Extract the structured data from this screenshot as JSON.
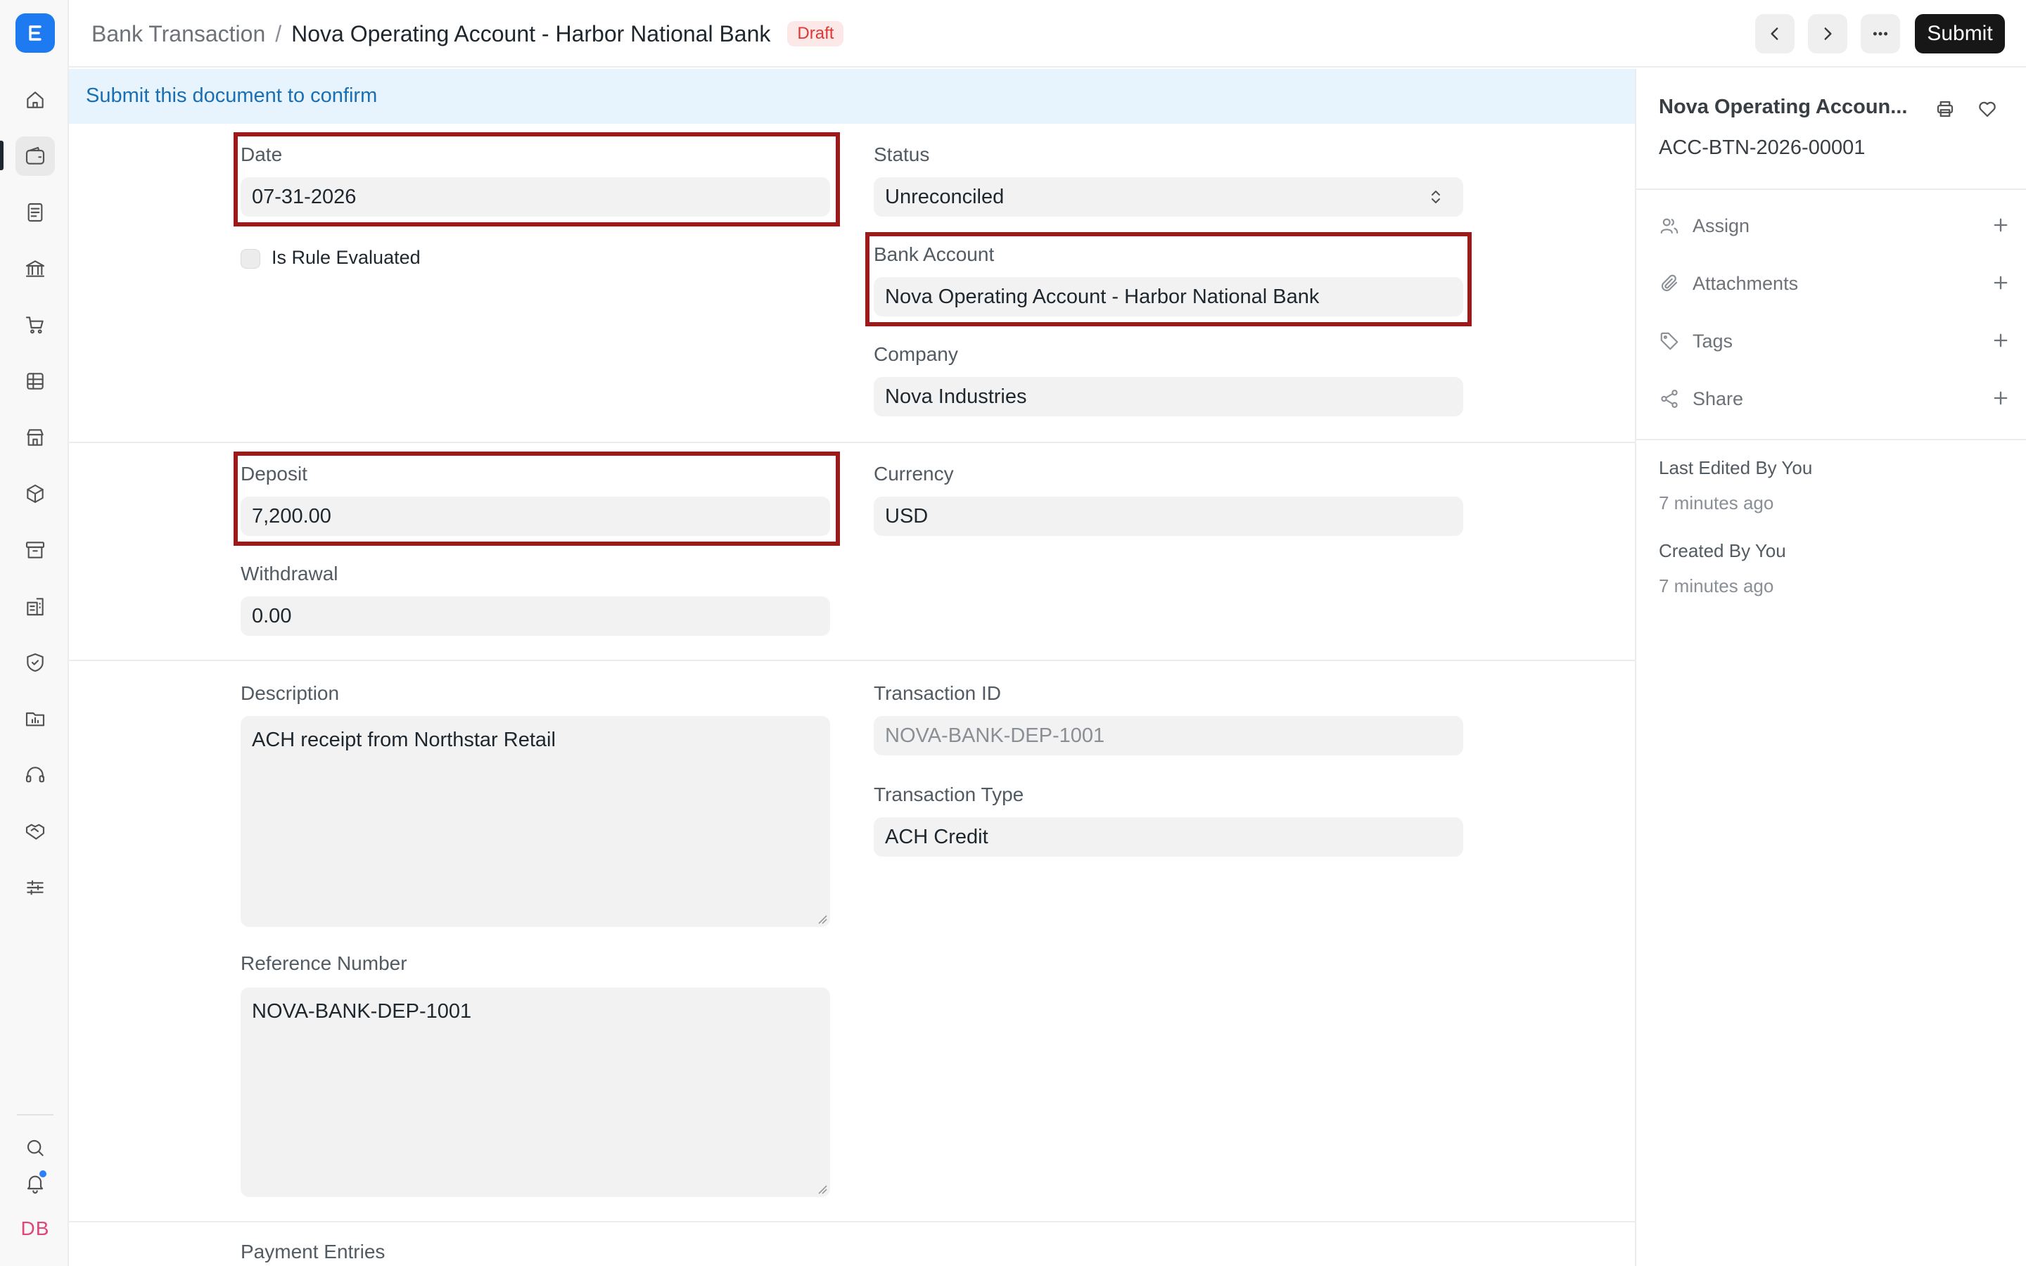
{
  "app": {
    "logo_letter": "E",
    "avatar_initials": "DB"
  },
  "breadcrumb": {
    "parent": "Bank Transaction",
    "separator": "/",
    "title": "Nova Operating Account - Harbor National Bank",
    "status_badge": "Draft"
  },
  "toolbar": {
    "submit_label": "Submit"
  },
  "banner": {
    "text": "Submit this document to confirm"
  },
  "form": {
    "date": {
      "label": "Date",
      "value": "07-31-2026"
    },
    "is_rule_evaluated": {
      "label": "Is Rule Evaluated",
      "checked": false
    },
    "status": {
      "label": "Status",
      "value": "Unreconciled"
    },
    "bank_account": {
      "label": "Bank Account",
      "value": "Nova Operating Account - Harbor National Bank"
    },
    "company": {
      "label": "Company",
      "value": "Nova Industries"
    },
    "deposit": {
      "label": "Deposit",
      "value": "7,200.00"
    },
    "currency": {
      "label": "Currency",
      "value": "USD"
    },
    "withdrawal": {
      "label": "Withdrawal",
      "value": "0.00"
    },
    "description": {
      "label": "Description",
      "value": "ACH receipt from Northstar Retail"
    },
    "transaction_id": {
      "label": "Transaction ID",
      "value": "NOVA-BANK-DEP-1001"
    },
    "transaction_type": {
      "label": "Transaction Type",
      "value": "ACH Credit"
    },
    "reference_number": {
      "label": "Reference Number",
      "value": "NOVA-BANK-DEP-1001"
    },
    "payment_entries": {
      "label": "Payment Entries"
    }
  },
  "sidebar": {
    "title": "Nova Operating Accoun...",
    "doc_id": "ACC-BTN-2026-00001",
    "actions": [
      {
        "label": "Assign",
        "icon": "users-icon"
      },
      {
        "label": "Attachments",
        "icon": "paperclip-icon"
      },
      {
        "label": "Tags",
        "icon": "tag-icon"
      },
      {
        "label": "Share",
        "icon": "share-icon"
      }
    ],
    "last_edited": {
      "label": "Last Edited By You",
      "time": "7 minutes ago"
    },
    "created": {
      "label": "Created By You",
      "time": "7 minutes ago"
    }
  },
  "colors": {
    "accent": "#1e7af0",
    "highlight_border": "#9b1b1b",
    "banner_bg": "#e7f4fd",
    "draft_badge": "#e03636"
  }
}
